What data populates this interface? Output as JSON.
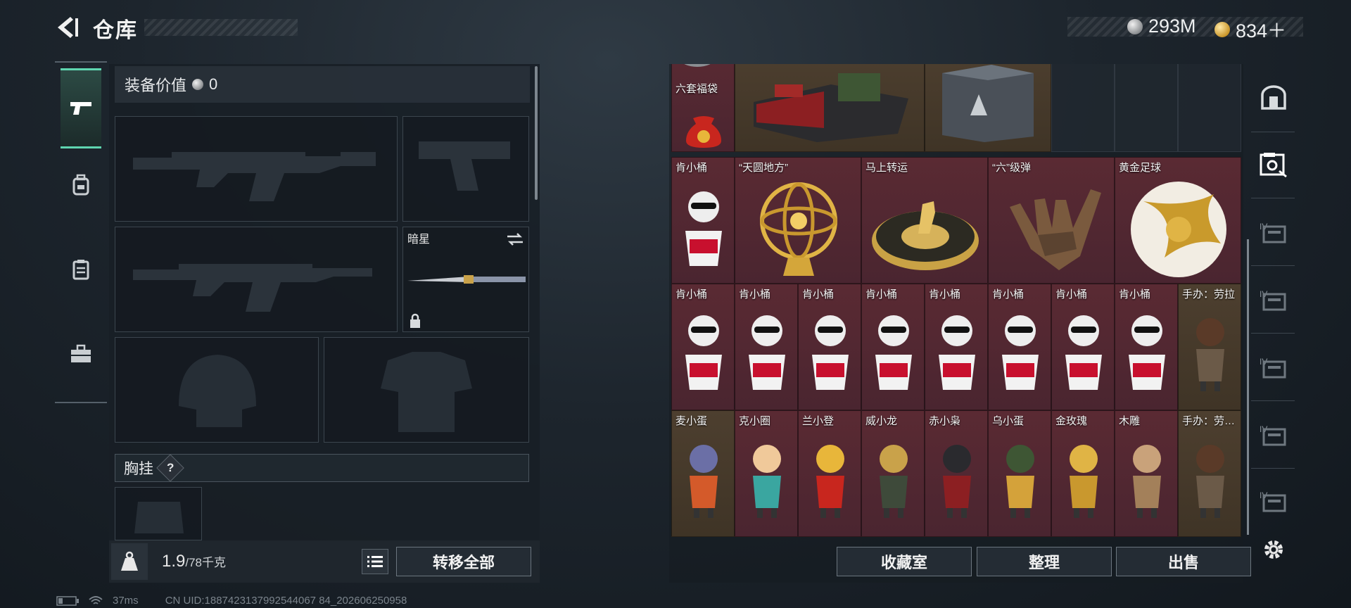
{
  "header": {
    "title": "仓库"
  },
  "currency": {
    "silver": "293M",
    "gold": "834＋"
  },
  "equipment": {
    "value_label": "装备价值",
    "value": "0",
    "melee_name": "暗星",
    "chest_label": "胸挂",
    "help": "?"
  },
  "weight": {
    "current": "1.9",
    "max": "/78千克"
  },
  "buttons": {
    "transfer_all": "转移全部",
    "collection": "收藏室",
    "organize": "整理",
    "sell": "出售"
  },
  "status": {
    "ping": "37ms",
    "uid": "CN UID:1887423137992544067 84_202606250958"
  },
  "grid": {
    "row0": [
      {
        "label": "六套福袋",
        "icon": "lucky-bag-icon"
      }
    ],
    "row1": [
      {
        "label": "肯小桶",
        "icon": "kfc-bucket-figure-icon"
      },
      {
        "label": "“天圆地方”",
        "icon": "armillary-sphere-icon"
      },
      {
        "label": "马上转运",
        "icon": "golden-horse-disc-icon"
      },
      {
        "label": "“六”级弹",
        "icon": "bullet-hand-icon"
      },
      {
        "label": "黄金足球",
        "icon": "golden-football-icon"
      }
    ],
    "row2": [
      {
        "label": "肯小桶"
      },
      {
        "label": "肯小桶"
      },
      {
        "label": "肯小桶"
      },
      {
        "label": "肯小桶"
      },
      {
        "label": "肯小桶"
      },
      {
        "label": "肯小桶"
      },
      {
        "label": "肯小桶"
      },
      {
        "label": "肯小桶"
      },
      {
        "label": "手办：劳拉"
      }
    ],
    "row3": [
      {
        "label": "麦小蛋"
      },
      {
        "label": "克小圈"
      },
      {
        "label": "兰小登"
      },
      {
        "label": "威小龙"
      },
      {
        "label": "赤小枭"
      },
      {
        "label": "乌小蛋"
      },
      {
        "label": "金玫瑰"
      },
      {
        "label": "木雕"
      },
      {
        "label": "手办：劳…"
      }
    ]
  },
  "colors": {
    "accent": "#5fd6b0",
    "red_cell": "#5a2a33",
    "gold_cell": "#4d3f2f"
  }
}
